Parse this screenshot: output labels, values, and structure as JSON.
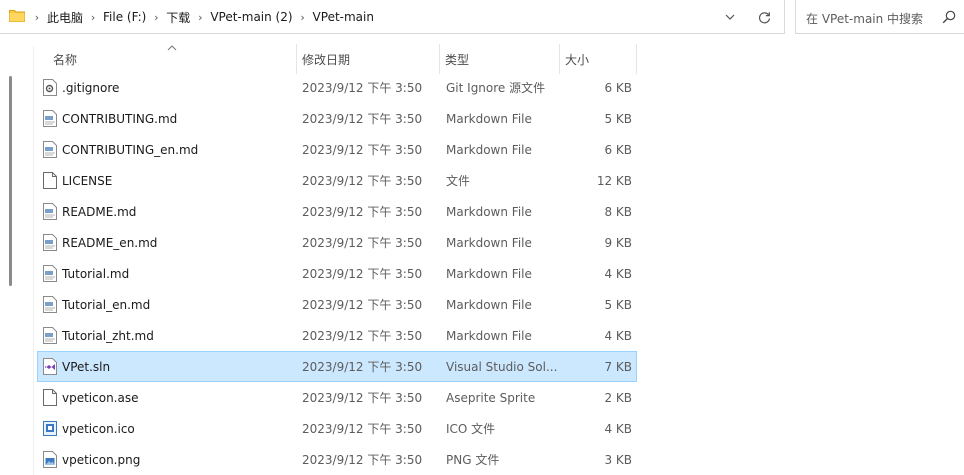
{
  "address": {
    "crumbs": [
      "此电脑",
      "File (F:)",
      "下载",
      "VPet-main (2)",
      "VPet-main"
    ]
  },
  "search": {
    "placeholder": "在 VPet-main 中搜索"
  },
  "columns": {
    "name": "名称",
    "date": "修改日期",
    "type": "类型",
    "size": "大小"
  },
  "files": [
    {
      "name": ".gitignore",
      "date": "2023/9/12 下午 3:50",
      "type": "Git Ignore 源文件",
      "size": "6 KB",
      "icon": "settings-file-icon"
    },
    {
      "name": "CONTRIBUTING.md",
      "date": "2023/9/12 下午 3:50",
      "type": "Markdown File",
      "size": "5 KB",
      "icon": "markdown-file-icon"
    },
    {
      "name": "CONTRIBUTING_en.md",
      "date": "2023/9/12 下午 3:50",
      "type": "Markdown File",
      "size": "6 KB",
      "icon": "markdown-file-icon"
    },
    {
      "name": "LICENSE",
      "date": "2023/9/12 下午 3:50",
      "type": "文件",
      "size": "12 KB",
      "icon": "blank-file-icon"
    },
    {
      "name": "README.md",
      "date": "2023/9/12 下午 3:50",
      "type": "Markdown File",
      "size": "8 KB",
      "icon": "markdown-file-icon"
    },
    {
      "name": "README_en.md",
      "date": "2023/9/12 下午 3:50",
      "type": "Markdown File",
      "size": "9 KB",
      "icon": "markdown-file-icon"
    },
    {
      "name": "Tutorial.md",
      "date": "2023/9/12 下午 3:50",
      "type": "Markdown File",
      "size": "4 KB",
      "icon": "markdown-file-icon"
    },
    {
      "name": "Tutorial_en.md",
      "date": "2023/9/12 下午 3:50",
      "type": "Markdown File",
      "size": "5 KB",
      "icon": "markdown-file-icon"
    },
    {
      "name": "Tutorial_zht.md",
      "date": "2023/9/12 下午 3:50",
      "type": "Markdown File",
      "size": "4 KB",
      "icon": "markdown-file-icon"
    },
    {
      "name": "VPet.sln",
      "date": "2023/9/12 下午 3:50",
      "type": "Visual Studio Sol...",
      "size": "7 KB",
      "icon": "visual-studio-solution-icon",
      "selected": true
    },
    {
      "name": "vpeticon.ase",
      "date": "2023/9/12 下午 3:50",
      "type": "Aseprite Sprite",
      "size": "2 KB",
      "icon": "aseprite-file-icon"
    },
    {
      "name": "vpeticon.ico",
      "date": "2023/9/12 下午 3:50",
      "type": "ICO 文件",
      "size": "4 KB",
      "icon": "ico-image-icon"
    },
    {
      "name": "vpeticon.png",
      "date": "2023/9/12 下午 3:50",
      "type": "PNG 文件",
      "size": "3 KB",
      "icon": "png-image-icon"
    }
  ],
  "colors": {
    "selection_bg": "#cce8ff",
    "selection_border": "#99d1ff",
    "folder_yellow": "#f8c93e"
  }
}
